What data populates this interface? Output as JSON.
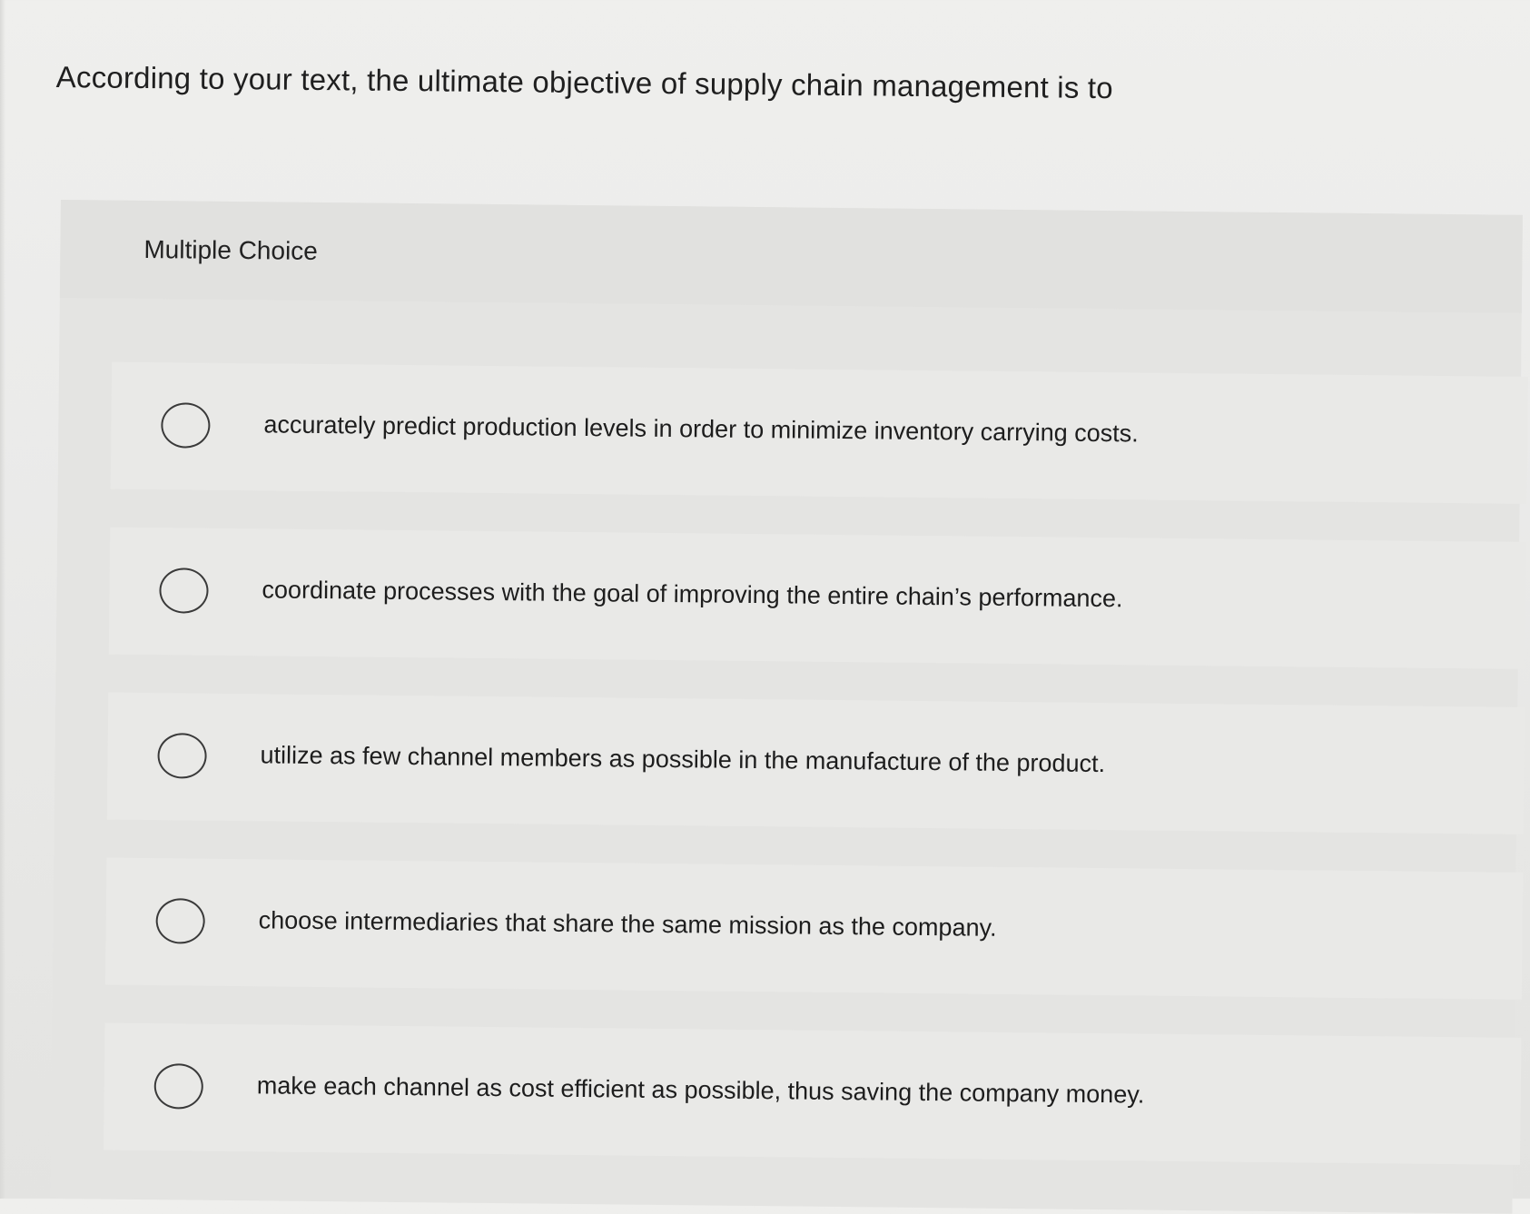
{
  "question": {
    "text": "According to your text, the ultimate objective of supply chain management is to"
  },
  "multiple_choice": {
    "label": "Multiple Choice",
    "options": [
      {
        "text": "accurately predict production levels in order to minimize inventory carrying costs.",
        "selected": false
      },
      {
        "text": "coordinate processes with the goal of improving the entire chain’s performance.",
        "selected": false
      },
      {
        "text": "utilize as few channel members as possible in the manufacture of the product.",
        "selected": false
      },
      {
        "text": "choose intermediaries that share the same mission as the company.",
        "selected": false
      },
      {
        "text": "make each channel as cost efficient as possible, thus saving the company money.",
        "selected": false
      }
    ]
  }
}
